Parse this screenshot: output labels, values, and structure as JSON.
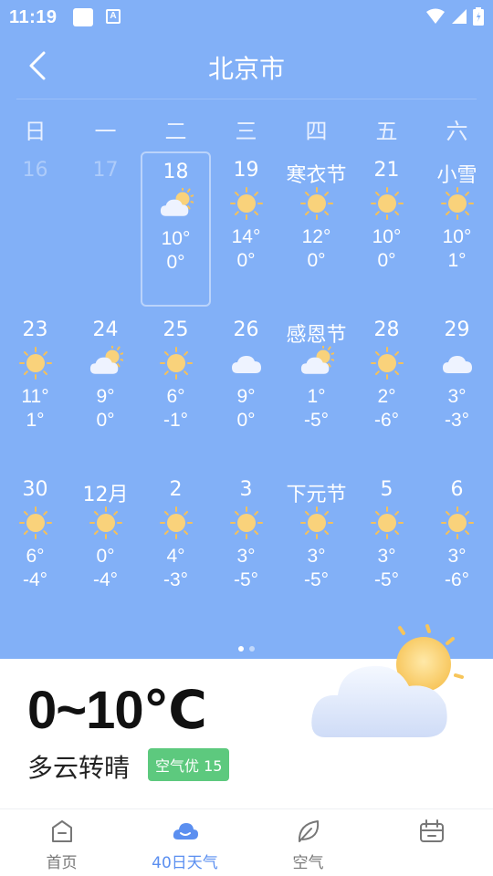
{
  "status_bar": {
    "time": "11:19",
    "a_icon": "A"
  },
  "header": {
    "city": "北京市"
  },
  "weekdays": [
    "日",
    "一",
    "二",
    "三",
    "四",
    "五",
    "六"
  ],
  "weeks": [
    [
      {
        "label": "16",
        "past": true
      },
      {
        "label": "17",
        "past": true
      },
      {
        "label": "18",
        "icon": "partly-cloudy",
        "high": "10°",
        "low": "0°",
        "selected": true
      },
      {
        "label": "19",
        "icon": "sunny",
        "high": "14°",
        "low": "0°"
      },
      {
        "label": "寒衣节",
        "icon": "sunny",
        "high": "12°",
        "low": "0°"
      },
      {
        "label": "21",
        "icon": "sunny",
        "high": "10°",
        "low": "0°"
      },
      {
        "label": "小雪",
        "icon": "sunny",
        "high": "10°",
        "low": "1°"
      }
    ],
    [
      {
        "label": "23",
        "icon": "sunny",
        "high": "11°",
        "low": "1°"
      },
      {
        "label": "24",
        "icon": "partly-cloudy",
        "high": "9°",
        "low": "0°"
      },
      {
        "label": "25",
        "icon": "sunny",
        "high": "6°",
        "low": "-1°"
      },
      {
        "label": "26",
        "icon": "cloudy",
        "high": "9°",
        "low": "0°"
      },
      {
        "label": "感恩节",
        "icon": "partly-cloudy",
        "high": "1°",
        "low": "-5°"
      },
      {
        "label": "28",
        "icon": "sunny",
        "high": "2°",
        "low": "-6°"
      },
      {
        "label": "29",
        "icon": "cloudy",
        "high": "3°",
        "low": "-3°"
      }
    ],
    [
      {
        "label": "30",
        "icon": "sunny",
        "high": "6°",
        "low": "-4°"
      },
      {
        "label": "12月",
        "icon": "sunny",
        "high": "0°",
        "low": "-4°"
      },
      {
        "label": "2",
        "icon": "sunny",
        "high": "4°",
        "low": "-3°"
      },
      {
        "label": "3",
        "icon": "sunny",
        "high": "3°",
        "low": "-5°"
      },
      {
        "label": "下元节",
        "icon": "sunny",
        "high": "3°",
        "low": "-5°"
      },
      {
        "label": "5",
        "icon": "sunny",
        "high": "3°",
        "low": "-5°"
      },
      {
        "label": "6",
        "icon": "sunny",
        "high": "3°",
        "low": "-6°"
      }
    ]
  ],
  "summary": {
    "temp_range": "0~10℃",
    "condition": "多云转晴",
    "aqi": "空气优 15",
    "icon": "partly-cloudy"
  },
  "tabs": [
    {
      "label": "首页",
      "icon": "home-icon"
    },
    {
      "label": "40日天气",
      "icon": "cloud-icon",
      "active": true
    },
    {
      "label": "空气",
      "icon": "leaf-icon"
    },
    {
      "label": "",
      "icon": "calendar-icon"
    }
  ],
  "colors": {
    "sky": "#82b0f7",
    "sun": "#f9cf6b",
    "cloud": "#e9f0ff",
    "active_tab": "#5b8ff0",
    "aqi_badge": "#5dc97e"
  }
}
